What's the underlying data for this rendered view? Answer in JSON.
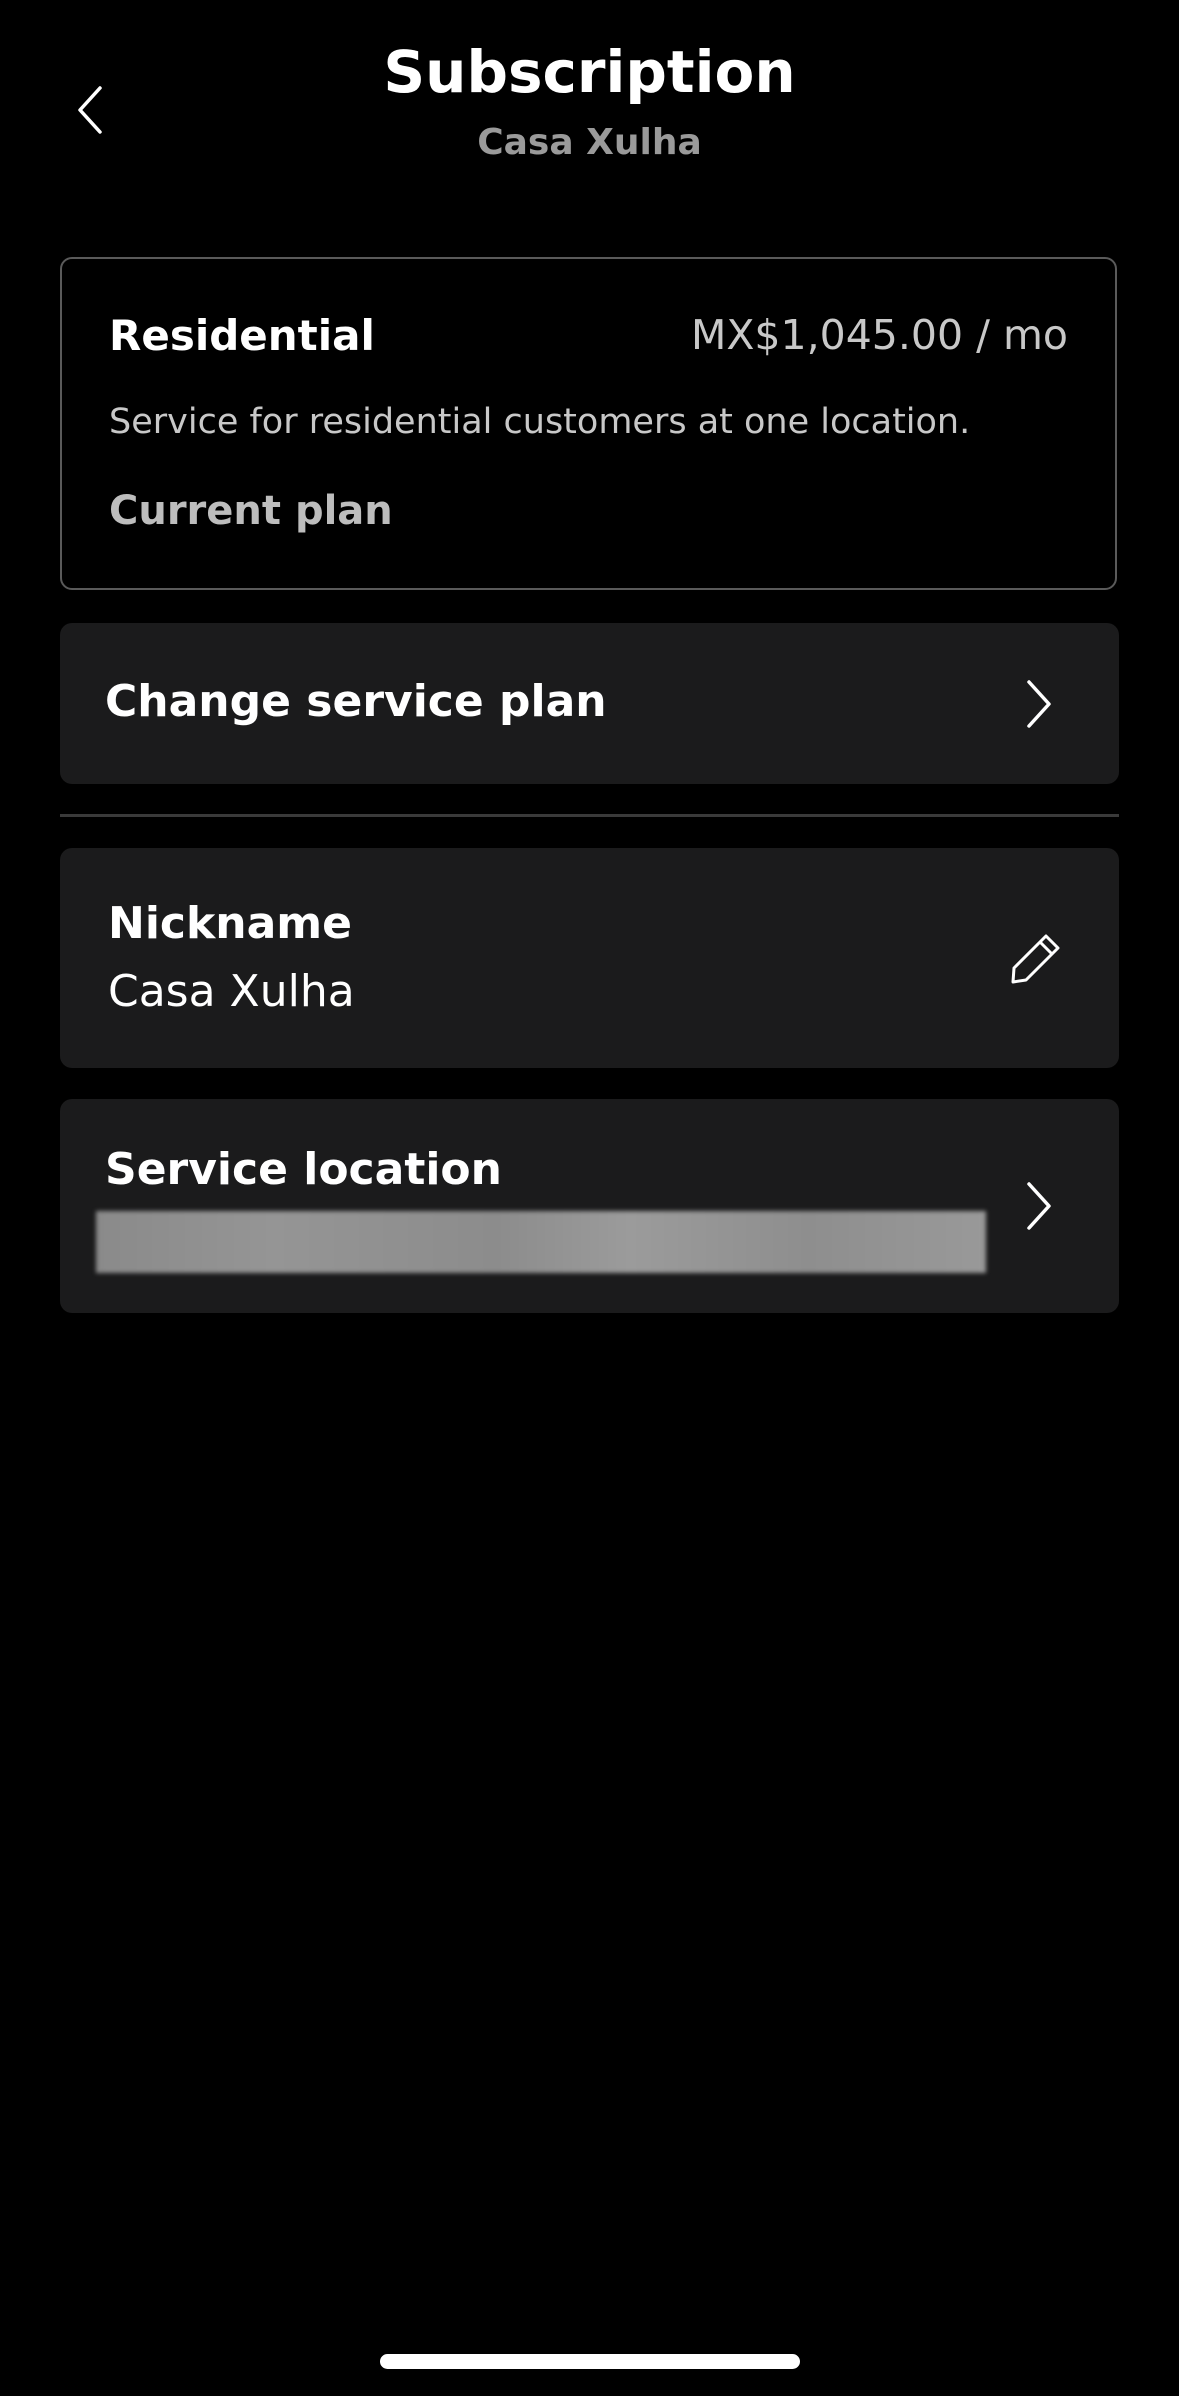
{
  "header": {
    "title": "Subscription",
    "subtitle": "Casa Xulha",
    "back_icon": "chevron-left-icon"
  },
  "plan": {
    "name": "Residential",
    "price": "MX$1,045.00 / mo",
    "description": "Service for residential customers at one location.",
    "status": "Current plan"
  },
  "change_plan": {
    "label": "Change service plan",
    "icon": "chevron-right-icon"
  },
  "nickname": {
    "label": "Nickname",
    "value": "Casa Xulha",
    "icon": "pencil-icon"
  },
  "service_location": {
    "label": "Service location",
    "icon": "chevron-right-icon"
  },
  "colors": {
    "background": "#000000",
    "card": "#1b1b1c",
    "border": "#5a5a5a",
    "text_primary": "#ffffff",
    "text_secondary": "#9a9a9a"
  }
}
